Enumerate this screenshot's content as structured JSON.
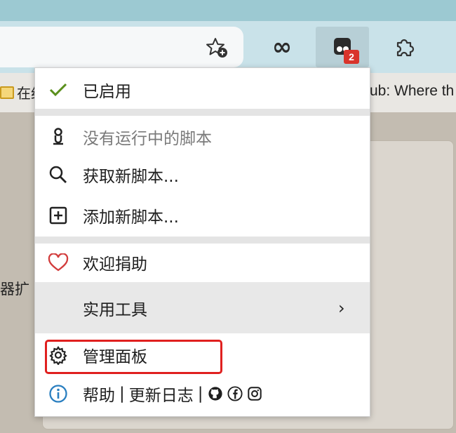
{
  "browser": {
    "toolbar": {
      "extension_badge": "2"
    },
    "bookmarks": {
      "left_text": "在约",
      "right_text": "ub: Where th"
    },
    "content": {
      "side_text": "器扩"
    }
  },
  "menu": {
    "items": [
      {
        "label": "已启用",
        "icon": "check-icon"
      },
      {
        "label": "没有运行中的脚本",
        "icon": "script-icon"
      },
      {
        "label": "获取新脚本...",
        "icon": "search-icon"
      },
      {
        "label": "添加新脚本...",
        "icon": "plus-box-icon"
      },
      {
        "label": "欢迎捐助",
        "icon": "heart-icon"
      },
      {
        "label": "实用工具",
        "icon": ""
      },
      {
        "label": "管理面板",
        "icon": "gear-icon"
      }
    ],
    "help_row": {
      "help": "帮助",
      "sep1": "|",
      "changelog": "更新日志",
      "sep2": "|"
    }
  },
  "colors": {
    "check": "#5a8f1c",
    "heart": "#d23c3c",
    "info": "#2a7fc0",
    "highlight_box": "#e0201f",
    "badge": "#d9342b"
  }
}
